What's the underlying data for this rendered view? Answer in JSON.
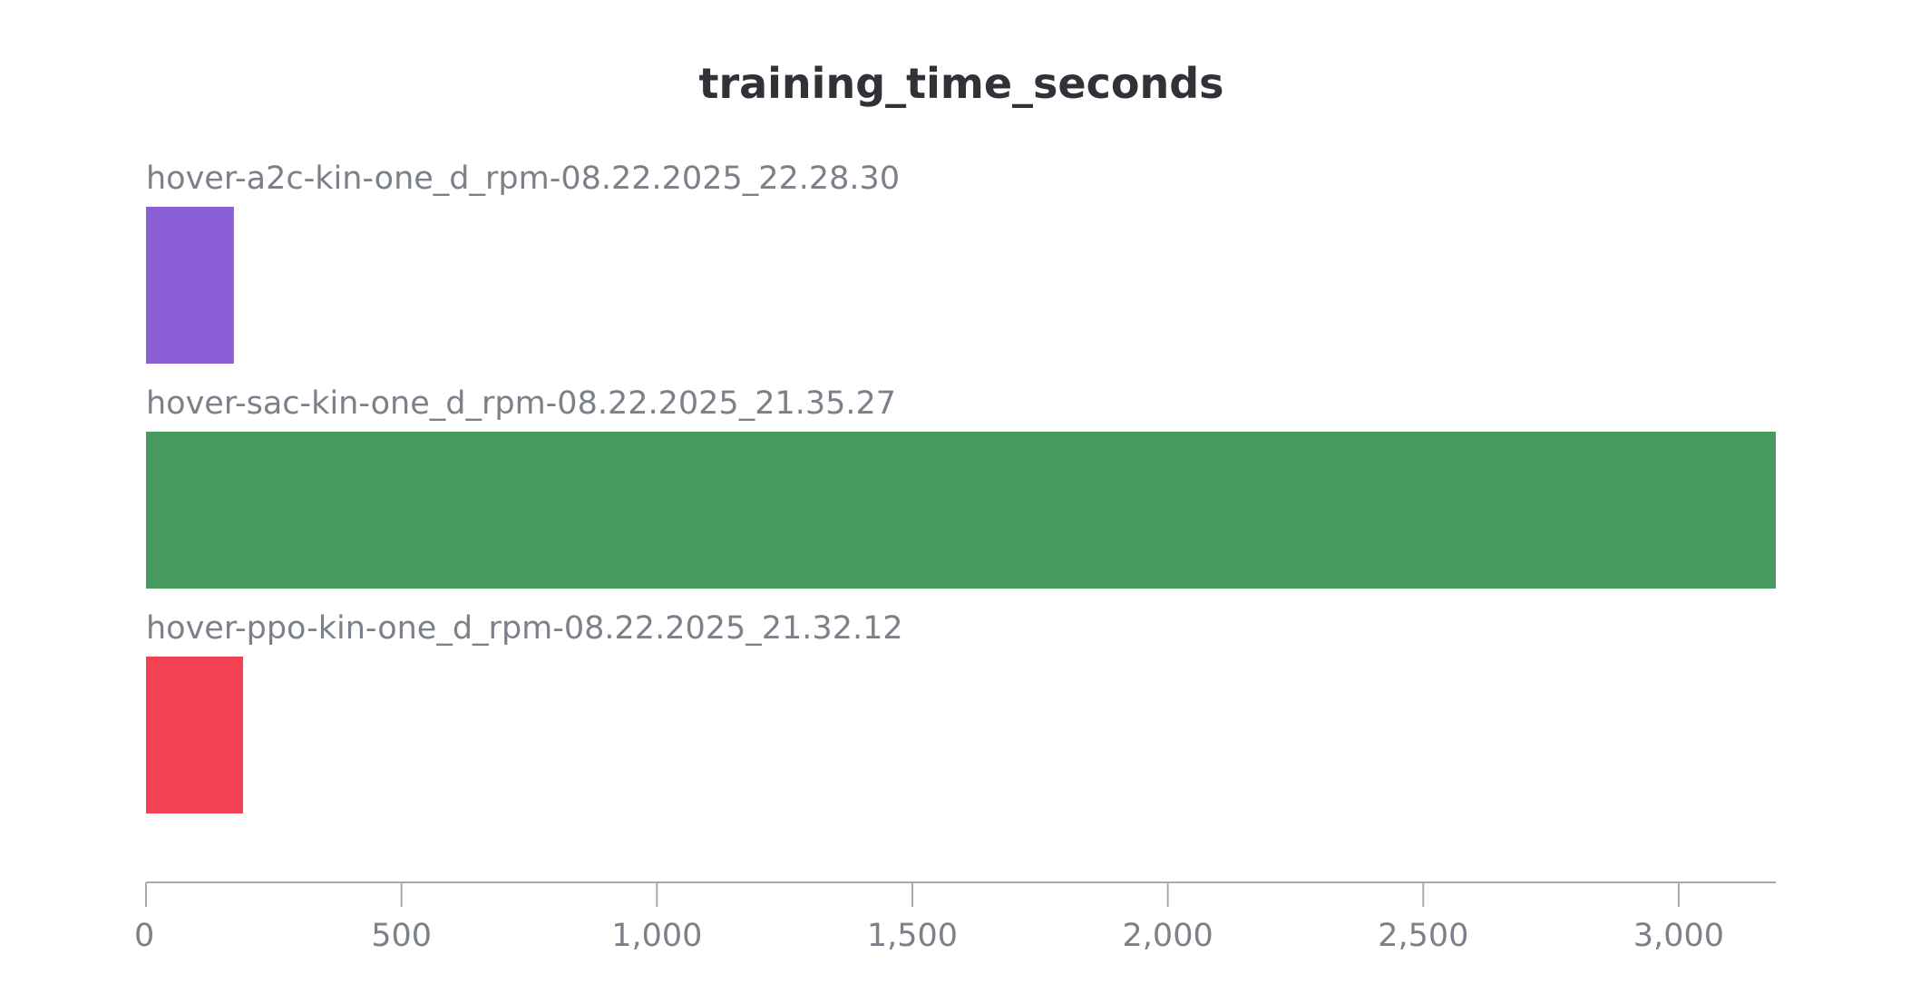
{
  "chart_data": {
    "type": "bar",
    "orientation": "horizontal",
    "title": "training_time_seconds",
    "xlabel": "",
    "ylabel": "",
    "categories": [
      "hover-a2c-kin-one_d_rpm-08.22.2025_22.28.30",
      "hover-sac-kin-one_d_rpm-08.22.2025_21.35.27",
      "hover-ppo-kin-one_d_rpm-08.22.2025_21.32.12"
    ],
    "values": [
      172,
      3190,
      190
    ],
    "colors": [
      "#8a5fd6",
      "#469a5e",
      "#f24150"
    ],
    "xlim": [
      0,
      3190
    ],
    "ticks": [
      0,
      500,
      1000,
      1500,
      2000,
      2500,
      3000
    ],
    "tick_labels": [
      "0",
      "500",
      "1,000",
      "1,500",
      "2,000",
      "2,500",
      "3,000"
    ],
    "grid": false,
    "legend": "none"
  }
}
